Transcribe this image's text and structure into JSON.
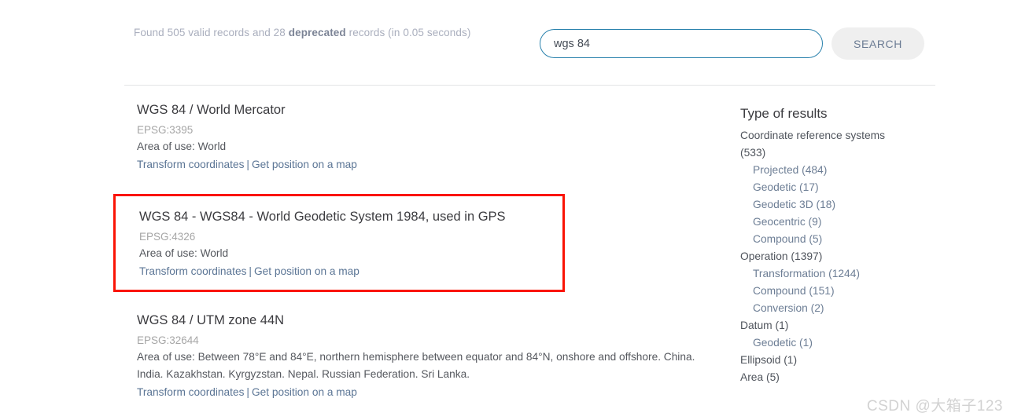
{
  "header": {
    "stats_prefix": "Found 505 valid records and 28 ",
    "stats_deprecated": "deprecated",
    "stats_suffix": " records (in 0.05 seconds)",
    "search_value": "wgs 84",
    "search_placeholder": "",
    "search_button_label": "SEARCH"
  },
  "results": [
    {
      "title": "WGS 84 / World Mercator",
      "epsg": "EPSG:3395",
      "area": "Area of use: World",
      "link_transform": "Transform coordinates",
      "link_sep": "|",
      "link_map": "Get position on a map"
    },
    {
      "title": "WGS 84 - WGS84 - World Geodetic System 1984, used in GPS",
      "epsg": "EPSG:4326",
      "area": "Area of use: World",
      "link_transform": "Transform coordinates",
      "link_sep": "|",
      "link_map": "Get position on a map"
    },
    {
      "title": "WGS 84 / UTM zone 44N",
      "epsg": "EPSG:32644",
      "area": "Area of use: Between 78°E and 84°E, northern hemisphere between equator and 84°N, onshore and offshore. China. India. Kazakhstan. Kyrgyzstan. Nepal. Russian Federation. Sri Lanka.",
      "link_transform": "Transform coordinates",
      "link_sep": "|",
      "link_map": "Get position on a map"
    }
  ],
  "sidebar": {
    "title": "Type of results",
    "items": [
      {
        "label": "Coordinate reference systems (533)",
        "level": "top"
      },
      {
        "label": "Projected (484)",
        "level": "sub"
      },
      {
        "label": "Geodetic (17)",
        "level": "sub"
      },
      {
        "label": "Geodetic 3D (18)",
        "level": "sub"
      },
      {
        "label": "Geocentric (9)",
        "level": "sub"
      },
      {
        "label": "Compound (5)",
        "level": "sub"
      },
      {
        "label": "Operation (1397)",
        "level": "top"
      },
      {
        "label": "Transformation (1244)",
        "level": "sub"
      },
      {
        "label": "Compound (151)",
        "level": "sub"
      },
      {
        "label": "Conversion (2)",
        "level": "sub"
      },
      {
        "label": "Datum (1)",
        "level": "top"
      },
      {
        "label": "Geodetic (1)",
        "level": "sub"
      },
      {
        "label": "Ellipsoid (1)",
        "level": "top"
      },
      {
        "label": "Area (5)",
        "level": "top"
      }
    ]
  },
  "annotation": {
    "highlight_color": "#fa1405"
  },
  "watermark": {
    "text": "CSDN @大箱子123"
  }
}
